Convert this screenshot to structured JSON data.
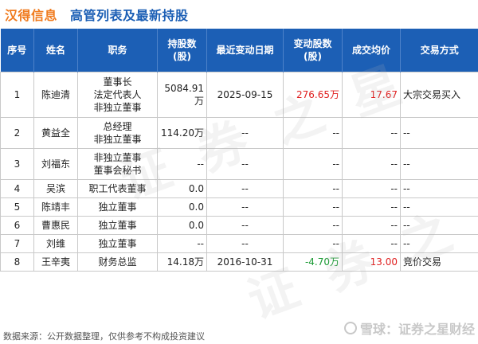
{
  "header": {
    "company": "汉得信息",
    "title": "高管列表及最新持股"
  },
  "table": {
    "columns": [
      "序号",
      "姓名",
      "职务",
      "持股数\n(股)",
      "最近变动日期",
      "变动股数\n(股)",
      "成交均价",
      "交易方式"
    ],
    "rows": [
      {
        "no": "1",
        "name": "陈迪清",
        "duties": [
          "董事长",
          "法定代表人",
          "非独立董事"
        ],
        "shares": "5084.91万",
        "date": "2025-09-15",
        "change": "276.65万",
        "price": "17.67",
        "method": "大宗交易买入"
      },
      {
        "no": "2",
        "name": "黄益全",
        "duties": [
          "总经理",
          "非独立董事"
        ],
        "shares": "114.20万",
        "date": "--",
        "change": "--",
        "price": "--",
        "method": "--"
      },
      {
        "no": "3",
        "name": "刘福东",
        "duties": [
          "非独立董事",
          "董事会秘书"
        ],
        "shares": "--",
        "date": "--",
        "change": "--",
        "price": "--",
        "method": "--"
      },
      {
        "no": "4",
        "name": "吴滨",
        "duties": [
          "职工代表董事"
        ],
        "shares": "0.0",
        "date": "--",
        "change": "--",
        "price": "--",
        "method": "--"
      },
      {
        "no": "5",
        "name": "陈靖丰",
        "duties": [
          "独立董事"
        ],
        "shares": "0.0",
        "date": "--",
        "change": "--",
        "price": "--",
        "method": "--"
      },
      {
        "no": "6",
        "name": "曹惠民",
        "duties": [
          "独立董事"
        ],
        "shares": "0.0",
        "date": "--",
        "change": "--",
        "price": "--",
        "method": "--"
      },
      {
        "no": "7",
        "name": "刘维",
        "duties": [
          "独立董事"
        ],
        "shares": "--",
        "date": "--",
        "change": "--",
        "price": "--",
        "method": "--"
      },
      {
        "no": "8",
        "name": "王辛夷",
        "duties": [
          "财务总监"
        ],
        "shares": "14.18万",
        "date": "2016-10-31",
        "change": "-4.70万",
        "price": "13.00",
        "method": "竞价交易"
      }
    ]
  },
  "footer": {
    "source": "数据来源：公开数据整理，仅供参考不构成投资建议",
    "brand": "雪球：证券之星财经"
  },
  "watermark": "证券之星",
  "colors": {
    "header_bg": "#1c5fb5",
    "company": "#f07b1e",
    "positive": "#e02020",
    "negative": "#1a9a33"
  }
}
